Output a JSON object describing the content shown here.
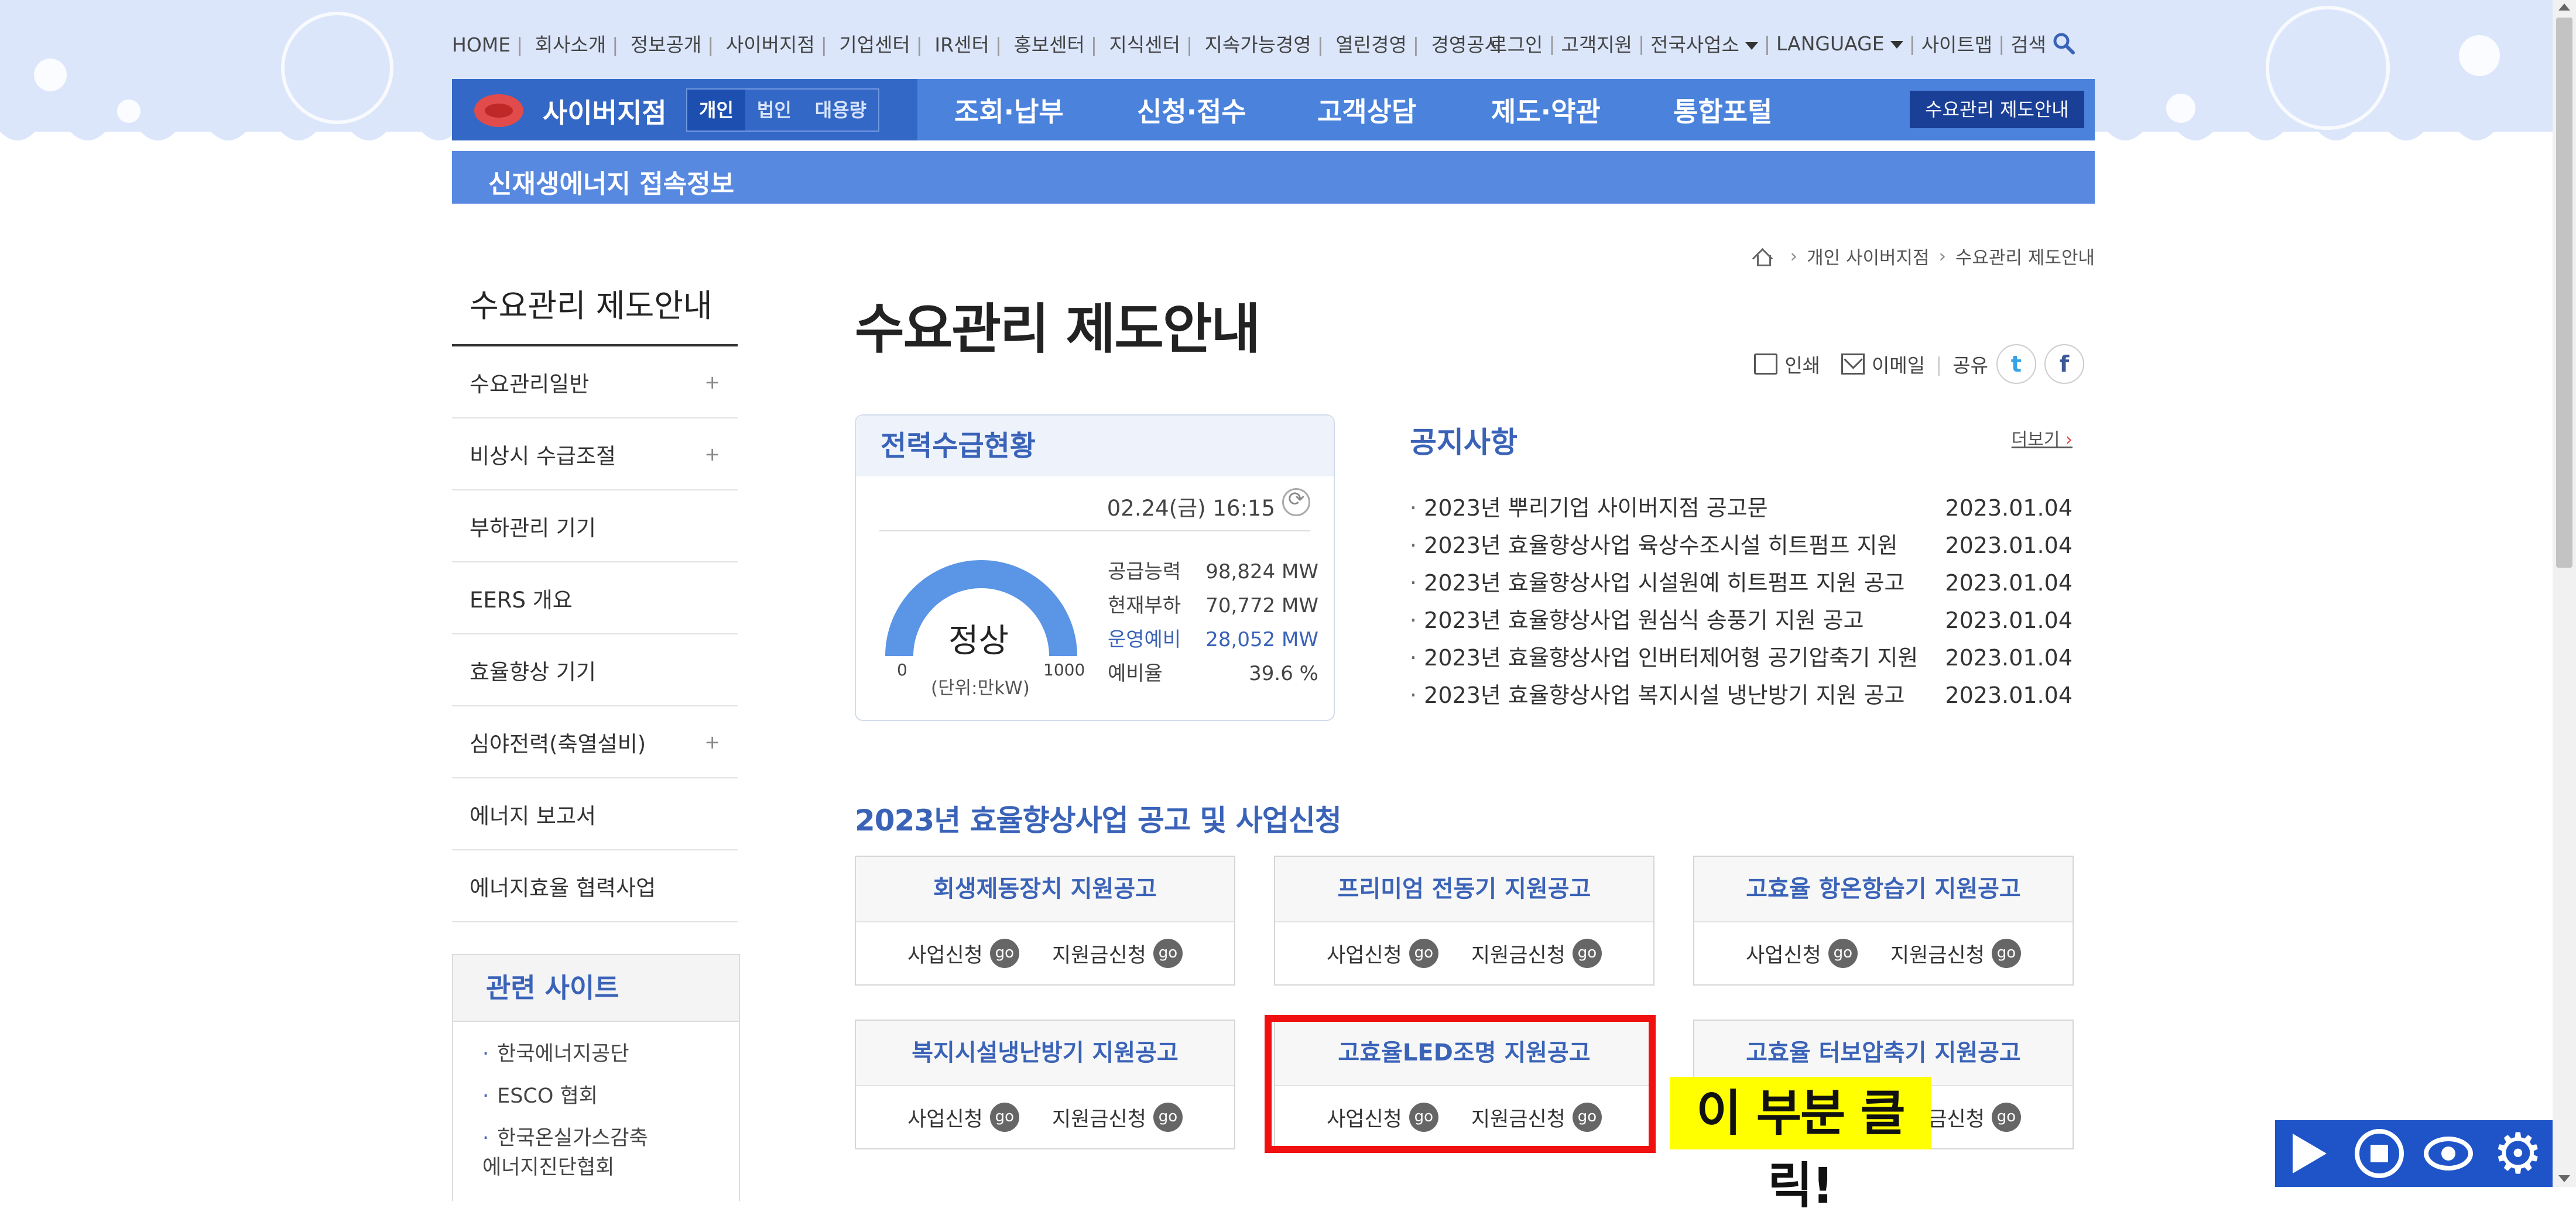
{
  "utility_nav": {
    "left": [
      "HOME",
      "회사소개",
      "정보공개",
      "사이버지점",
      "기업센터",
      "IR센터",
      "홍보센터",
      "지식센터",
      "지속가능경영",
      "열린경영",
      "경영공시"
    ],
    "right": [
      "로그인",
      "고객지원",
      "전국사업소",
      "LANGUAGE",
      "사이트맵",
      "검색"
    ]
  },
  "gnb": {
    "branch": "사이버지점",
    "segments": [
      "개인",
      "법인",
      "대용량"
    ],
    "menus": [
      "조회·납부",
      "신청·접수",
      "고객상담",
      "제도·약관",
      "통합포털"
    ],
    "current_page_tab": "수요관리 제도안내"
  },
  "subbar": {
    "label": "신재생에너지 접속정보"
  },
  "breadcrumb": [
    "개인 사이버지점",
    "수요관리 제도안내"
  ],
  "lnb": {
    "title": "수요관리 제도안내",
    "items": [
      {
        "label": "수요관리일반",
        "plus": "+"
      },
      {
        "label": "비상시 수급조절",
        "plus": "+"
      },
      {
        "label": "부하관리 기기",
        "plus": ""
      },
      {
        "label": "EERS 개요",
        "plus": ""
      },
      {
        "label": "효율향상 기기",
        "plus": ""
      },
      {
        "label": "심야전력(축열설비)",
        "plus": "+"
      },
      {
        "label": "에너지 보고서",
        "plus": ""
      },
      {
        "label": "에너지효율 협력사업",
        "plus": ""
      }
    ]
  },
  "related_sites": {
    "title": "관련 사이트",
    "items": [
      "한국에너지공단",
      "ESCO 협회",
      "한국온실가스감축 에너지진단협회"
    ]
  },
  "page_title": "수요관리 제도안내",
  "share": {
    "print": "인쇄",
    "email": "이메일",
    "share": "공유",
    "twitter": "t",
    "facebook": "f"
  },
  "power_status": {
    "title": "전력수급현황",
    "timestamp": "02.24(금) 16:15",
    "state": "정상",
    "gauge_min": "0",
    "gauge_max": "1000",
    "unit": "(단위:만kW)",
    "rows": [
      {
        "label": "공급능력",
        "value": "98,824 MW"
      },
      {
        "label": "현재부하",
        "value": "70,772 MW"
      },
      {
        "label": "운영예비",
        "value": "28,052 MW"
      },
      {
        "label": "예비율",
        "value": "39.6 %"
      }
    ]
  },
  "notice": {
    "title": "공지사항",
    "more": "더보기",
    "items": [
      {
        "title": "2023년 뿌리기업 사이버지점 공고문",
        "date": "2023.01.04"
      },
      {
        "title": "2023년 효율향상사업 육상수조시설 히트펌프 지원",
        "date": "2023.01.04"
      },
      {
        "title": "2023년 효율향상사업 시설원예 히트펌프 지원 공고",
        "date": "2023.01.04"
      },
      {
        "title": "2023년 효율향상사업 원심식 송풍기 지원 공고",
        "date": "2023.01.04"
      },
      {
        "title": "2023년 효율향상사업 인버터제어형 공기압축기 지원",
        "date": "2023.01.04"
      },
      {
        "title": "2023년 효율향상사업 복지시설 냉난방기 지원 공고",
        "date": "2023.01.04"
      }
    ]
  },
  "program_section": {
    "title": "2023년 효율향상사업 공고 및 사업신청",
    "apply_label": "사업신청",
    "subsidy_label": "지원금신청",
    "go": "go",
    "cards": [
      "회생제동장치 지원공고",
      "프리미엄 전동기 지원공고",
      "고효율 항온항습기 지원공고",
      "복지시설냉난방기 지원공고",
      "고효율LED조명 지원공고",
      "고효율 터보압축기 지원공고"
    ]
  },
  "annotation": {
    "callout": "이 부분 클릭!",
    "highlight_color": "#f01010",
    "callout_color": "#ffff00"
  },
  "colors": {
    "brand_blue": "#4a82dc",
    "accent_blue": "#3a63b8",
    "band": "#dbe6fb"
  },
  "recorder_icons": [
    "play-icon",
    "stop-icon",
    "eye-icon",
    "gear-icon"
  ]
}
